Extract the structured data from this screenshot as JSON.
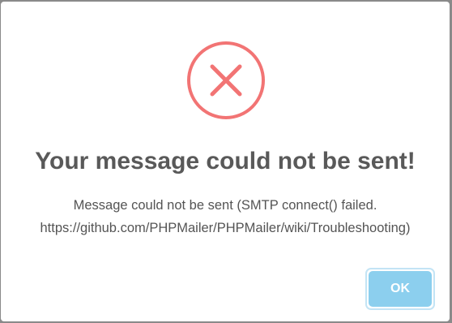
{
  "dialog": {
    "icon": "error-x-circle-icon",
    "title": "Your message could not be sent!",
    "message_line1": "Message could not be sent (SMTP connect() failed.",
    "message_line2": "https://github.com/PHPMailer/PHPMailer/wiki/Troubleshooting)",
    "ok_label": "OK"
  },
  "colors": {
    "error_red": "#f27474",
    "button_blue": "#8ccfee",
    "title_text": "#595959"
  }
}
